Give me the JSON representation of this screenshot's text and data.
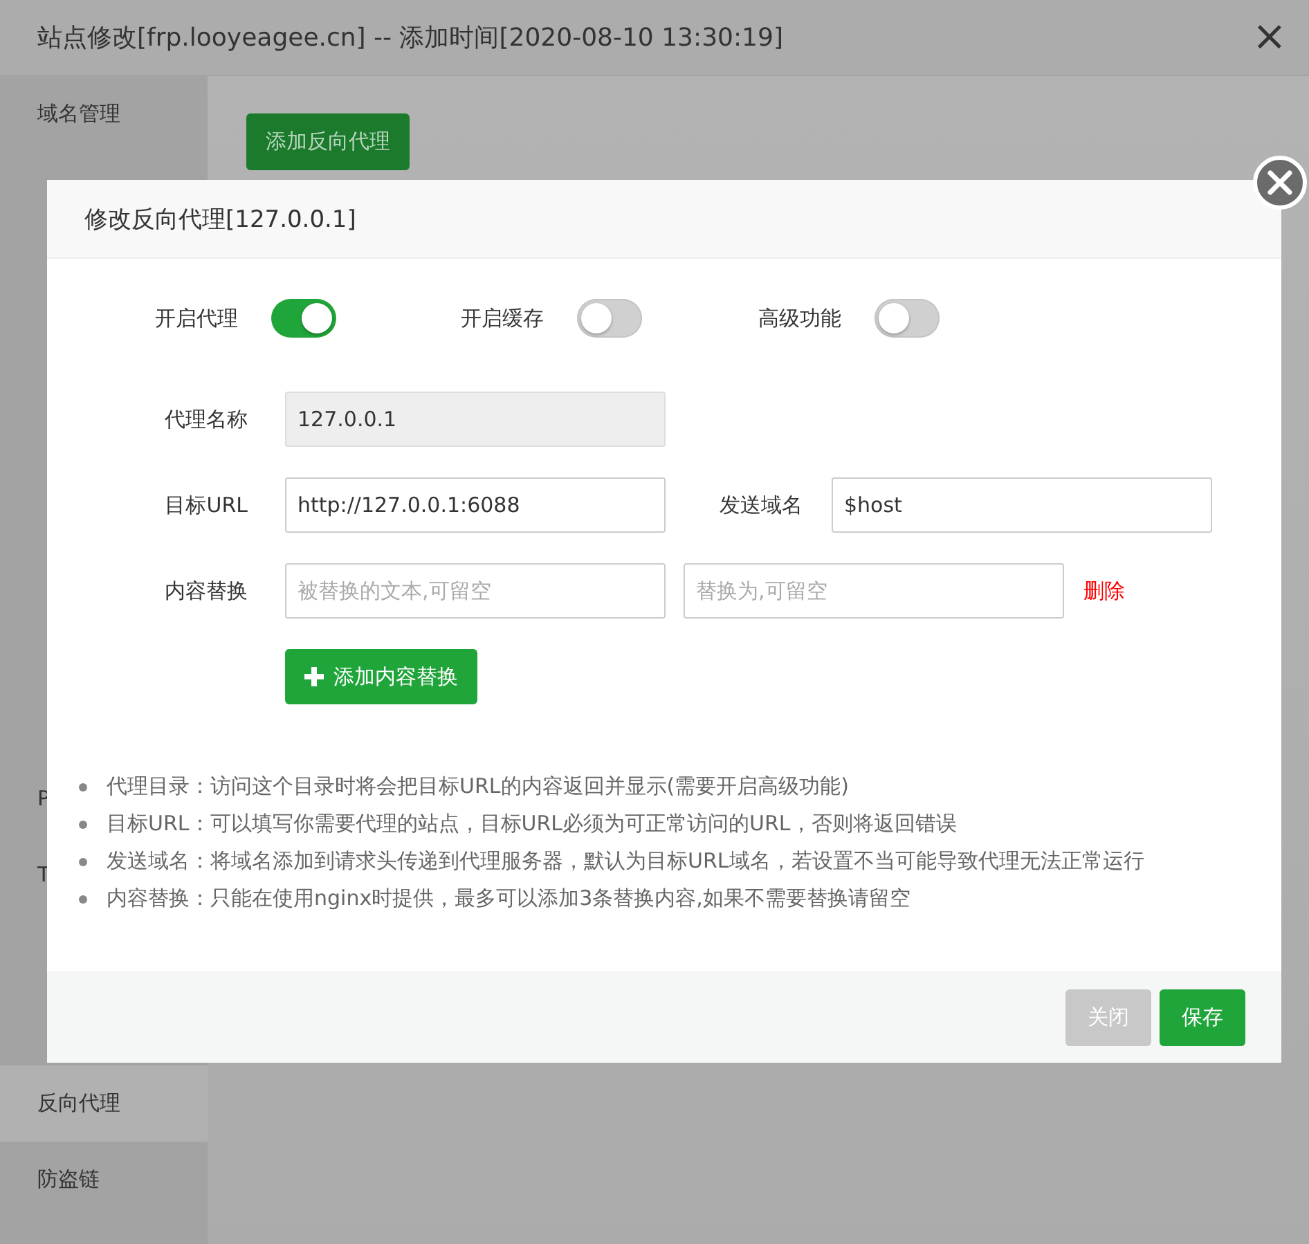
{
  "window": {
    "title": "站点修改[frp.looyeagee.cn] -- 添加时间[2020-08-10 13:30:19]",
    "close": "×"
  },
  "sidebar": {
    "items": [
      {
        "kind": "item",
        "label": "域名管理",
        "selected": false
      },
      {
        "kind": "covered"
      },
      {
        "kind": "covered"
      },
      {
        "kind": "covered"
      },
      {
        "kind": "covered"
      },
      {
        "kind": "covered"
      },
      {
        "kind": "covered"
      },
      {
        "kind": "covered"
      },
      {
        "kind": "covered"
      },
      {
        "kind": "item",
        "label": "P",
        "selected": false
      },
      {
        "kind": "item",
        "label": "T",
        "selected": false
      },
      {
        "kind": "covered"
      },
      {
        "kind": "covered"
      },
      {
        "kind": "item",
        "label": "反向代理",
        "selected": true
      },
      {
        "kind": "item",
        "label": "防盗链",
        "selected": false
      }
    ]
  },
  "content": {
    "add_button": "添加反向代理"
  },
  "dialog": {
    "title": "修改反向代理[127.0.0.1]",
    "toggles": [
      {
        "label": "开启代理",
        "on": true
      },
      {
        "label": "开启缓存",
        "on": false
      },
      {
        "label": "高级功能",
        "on": false
      }
    ],
    "name": {
      "label": "代理名称",
      "value": "127.0.0.1",
      "disabled": true
    },
    "target": {
      "label": "目标URL",
      "value": "http://127.0.0.1:6088"
    },
    "host": {
      "label": "发送域名",
      "value": "$host"
    },
    "replace": {
      "label": "内容替换",
      "from_placeholder": "被替换的文本,可留空",
      "to_placeholder": "替换为,可留空",
      "delete": "删除"
    },
    "add_replace": "添加内容替换",
    "notes": [
      "代理目录：访问这个目录时将会把目标URL的内容返回并显示(需要开启高级功能)",
      "目标URL：可以填写你需要代理的站点，目标URL必须为可正常访问的URL，否则将返回错误",
      "发送域名：将域名添加到请求头传递到代理服务器，默认为目标URL域名，若设置不当可能导致代理无法正常运行",
      "内容替换：只能在使用nginx时提供，最多可以添加3条替换内容,如果不需要替换请留空"
    ],
    "buttons": [
      "关闭",
      "保存"
    ]
  }
}
